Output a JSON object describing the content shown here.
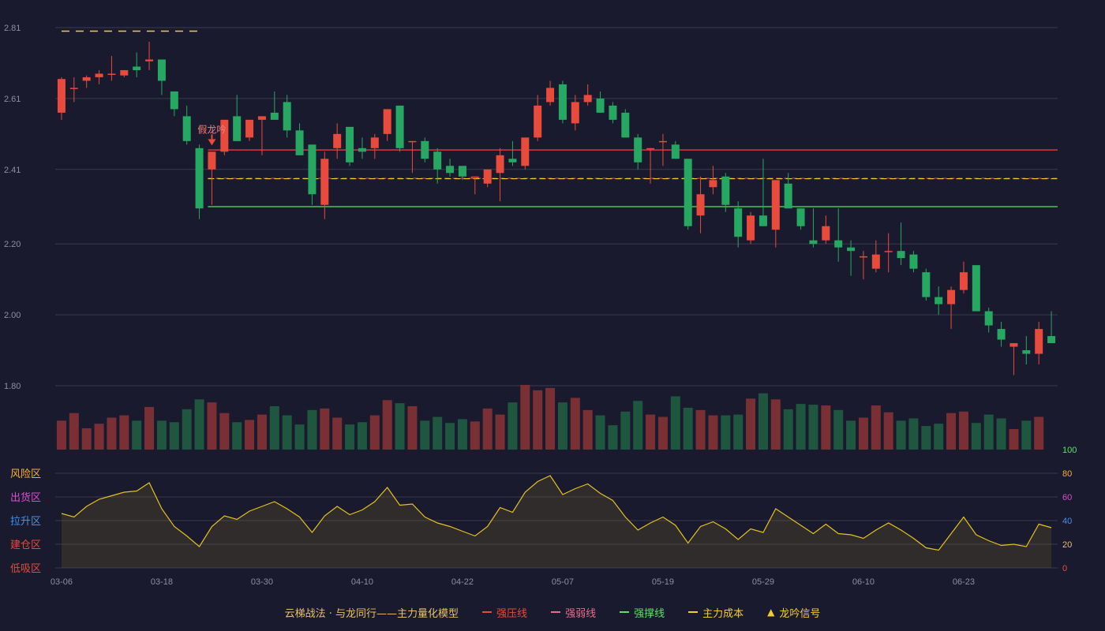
{
  "colors": {
    "background": "#191a2e",
    "up": "#e84a3c",
    "down": "#27a862",
    "up_volume": "#7a2f35",
    "down_volume": "#1f5640",
    "grid": "#3a3b4e",
    "axis_text": "#8d8ea0",
    "resistance": "#d23a43",
    "weak": "#b0508a",
    "support": "#5ce06a",
    "cost": "#f5cc2e",
    "oscillator": "#e6c020"
  },
  "signal_label": "假龙吟",
  "legend": {
    "title": "云梯战法 · 与龙同行——主力量化模型",
    "resistance": "强压线",
    "weak": "强弱线",
    "support": "强撑线",
    "cost": "主力成本",
    "signal": "龙吟信号",
    "signal_icon": "triangle-up"
  },
  "chart_data": [
    {
      "type": "candlestick",
      "y_ticks": [
        "2.81",
        "2.61",
        "2.41",
        "2.20",
        "2.00",
        "1.80"
      ],
      "ylim": [
        1.8,
        2.81
      ],
      "x_tick_labels": [
        "03-06",
        "03-18",
        "03-30",
        "04-10",
        "04-22",
        "05-07",
        "05-19",
        "05-29",
        "06-10",
        "06-23"
      ],
      "x_tick_index": [
        0,
        8,
        16,
        24,
        32,
        40,
        48,
        56,
        64,
        72
      ],
      "levels": {
        "resistance": 2.465,
        "weak": 2.385,
        "support": 2.305,
        "cost": 2.385,
        "cost_top": 2.8
      },
      "level_start_index": 12,
      "signal_index": 12,
      "ohlc": [
        [
          2.57,
          2.67,
          2.55,
          2.665
        ],
        [
          2.64,
          2.67,
          2.6,
          2.64
        ],
        [
          2.66,
          2.675,
          2.64,
          2.67
        ],
        [
          2.67,
          2.69,
          2.65,
          2.68
        ],
        [
          2.68,
          2.73,
          2.66,
          2.68
        ],
        [
          2.675,
          2.69,
          2.67,
          2.69
        ],
        [
          2.7,
          2.74,
          2.67,
          2.69
        ],
        [
          2.715,
          2.77,
          2.69,
          2.72
        ],
        [
          2.72,
          2.72,
          2.62,
          2.66
        ],
        [
          2.63,
          2.63,
          2.56,
          2.58
        ],
        [
          2.56,
          2.59,
          2.48,
          2.49
        ],
        [
          2.47,
          2.48,
          2.27,
          2.3
        ],
        [
          2.41,
          2.46,
          2.31,
          2.46
        ],
        [
          2.46,
          2.55,
          2.45,
          2.55
        ],
        [
          2.56,
          2.62,
          2.49,
          2.49
        ],
        [
          2.5,
          2.55,
          2.49,
          2.55
        ],
        [
          2.55,
          2.56,
          2.45,
          2.56
        ],
        [
          2.57,
          2.63,
          2.55,
          2.55
        ],
        [
          2.6,
          2.62,
          2.5,
          2.52
        ],
        [
          2.52,
          2.54,
          2.46,
          2.45
        ],
        [
          2.48,
          2.48,
          2.31,
          2.34
        ],
        [
          2.31,
          2.46,
          2.27,
          2.44
        ],
        [
          2.47,
          2.54,
          2.44,
          2.51
        ],
        [
          2.53,
          2.53,
          2.42,
          2.43
        ],
        [
          2.47,
          2.5,
          2.44,
          2.46
        ],
        [
          2.47,
          2.51,
          2.44,
          2.5
        ],
        [
          2.51,
          2.58,
          2.49,
          2.58
        ],
        [
          2.59,
          2.59,
          2.46,
          2.47
        ],
        [
          2.49,
          2.49,
          2.4,
          2.49
        ],
        [
          2.49,
          2.5,
          2.43,
          2.44
        ],
        [
          2.46,
          2.47,
          2.37,
          2.41
        ],
        [
          2.42,
          2.44,
          2.39,
          2.4
        ],
        [
          2.42,
          2.42,
          2.38,
          2.39
        ],
        [
          2.39,
          2.39,
          2.34,
          2.39
        ],
        [
          2.37,
          2.41,
          2.36,
          2.41
        ],
        [
          2.4,
          2.47,
          2.32,
          2.45
        ],
        [
          2.44,
          2.49,
          2.42,
          2.43
        ],
        [
          2.42,
          2.48,
          2.41,
          2.5
        ],
        [
          2.5,
          2.62,
          2.49,
          2.59
        ],
        [
          2.6,
          2.66,
          2.59,
          2.64
        ],
        [
          2.65,
          2.66,
          2.54,
          2.55
        ],
        [
          2.54,
          2.62,
          2.52,
          2.6
        ],
        [
          2.6,
          2.65,
          2.59,
          2.62
        ],
        [
          2.61,
          2.63,
          2.57,
          2.57
        ],
        [
          2.59,
          2.6,
          2.54,
          2.55
        ],
        [
          2.57,
          2.58,
          2.5,
          2.5
        ],
        [
          2.5,
          2.51,
          2.41,
          2.43
        ],
        [
          2.47,
          2.47,
          2.37,
          2.47
        ],
        [
          2.49,
          2.51,
          2.42,
          2.49
        ],
        [
          2.48,
          2.49,
          2.44,
          2.44
        ],
        [
          2.44,
          2.44,
          2.24,
          2.25
        ],
        [
          2.28,
          2.39,
          2.23,
          2.34
        ],
        [
          2.36,
          2.42,
          2.34,
          2.38
        ],
        [
          2.39,
          2.4,
          2.29,
          2.31
        ],
        [
          2.3,
          2.32,
          2.19,
          2.22
        ],
        [
          2.21,
          2.29,
          2.2,
          2.28
        ],
        [
          2.28,
          2.44,
          2.25,
          2.25
        ],
        [
          2.24,
          2.38,
          2.19,
          2.38
        ],
        [
          2.37,
          2.4,
          2.3,
          2.3
        ],
        [
          2.3,
          2.3,
          2.24,
          2.25
        ],
        [
          2.21,
          2.3,
          2.19,
          2.2
        ],
        [
          2.21,
          2.28,
          2.2,
          2.25
        ],
        [
          2.21,
          2.3,
          2.15,
          2.19
        ],
        [
          2.19,
          2.21,
          2.11,
          2.18
        ],
        [
          2.165,
          2.18,
          2.1,
          2.165
        ],
        [
          2.13,
          2.21,
          2.12,
          2.17
        ],
        [
          2.18,
          2.23,
          2.12,
          2.18
        ],
        [
          2.18,
          2.26,
          2.14,
          2.16
        ],
        [
          2.17,
          2.18,
          2.12,
          2.13
        ],
        [
          2.12,
          2.13,
          2.04,
          2.05
        ],
        [
          2.05,
          2.08,
          2.0,
          2.03
        ],
        [
          2.03,
          2.08,
          1.96,
          2.07
        ],
        [
          2.07,
          2.15,
          2.06,
          2.12
        ],
        [
          2.14,
          2.14,
          2.02,
          2.01
        ],
        [
          2.01,
          2.02,
          1.95,
          1.97
        ],
        [
          1.96,
          1.98,
          1.91,
          1.93
        ],
        [
          1.91,
          1.92,
          1.83,
          1.92
        ],
        [
          1.9,
          1.94,
          1.86,
          1.89
        ],
        [
          1.89,
          1.98,
          1.86,
          1.96
        ],
        [
          1.94,
          2.01,
          1.92,
          1.92
        ]
      ],
      "volume": [
        38,
        48,
        28,
        34,
        42,
        45,
        38,
        56,
        38,
        36,
        53,
        66,
        62,
        48,
        36,
        39,
        46,
        57,
        45,
        33,
        52,
        54,
        42,
        33,
        36,
        45,
        65,
        61,
        57,
        38,
        43,
        35,
        40,
        37,
        54,
        46,
        62,
        85,
        78,
        81,
        62,
        68,
        52,
        45,
        32,
        50,
        64,
        46,
        43,
        70,
        55,
        52,
        45,
        45,
        46,
        67,
        74,
        66,
        53,
        60,
        59,
        58,
        52,
        38,
        42,
        58,
        49,
        38,
        41,
        31,
        34,
        48,
        50,
        35,
        46,
        41,
        27,
        38,
        43
      ]
    },
    {
      "type": "line",
      "name": "oscillator",
      "ylim": [
        0,
        100
      ],
      "y_ticks": [
        "100",
        "80",
        "60",
        "40",
        "20",
        "0"
      ],
      "zones": [
        "风险区",
        "出货区",
        "拉升区",
        "建仓区",
        "低吸区"
      ],
      "values": [
        46,
        43,
        52,
        58,
        61,
        64,
        65,
        72,
        50,
        35,
        27,
        18,
        35,
        44,
        41,
        48,
        52,
        56,
        50,
        43,
        30,
        44,
        52,
        45,
        49,
        56,
        68,
        53,
        54,
        43,
        38,
        35,
        31,
        27,
        35,
        51,
        47,
        64,
        73,
        78,
        62,
        67,
        71,
        63,
        57,
        43,
        32,
        38,
        43,
        36,
        21,
        35,
        39,
        33,
        24,
        33,
        30,
        50,
        43,
        36,
        29,
        37,
        29,
        28,
        25,
        32,
        38,
        32,
        25,
        17,
        15,
        29,
        43,
        28,
        23,
        19,
        20,
        18,
        37,
        34
      ]
    }
  ]
}
